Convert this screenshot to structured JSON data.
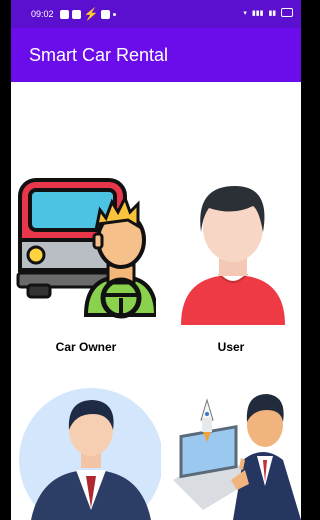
{
  "status": {
    "time": "09:02"
  },
  "appbar": {
    "title": "Smart Car Rental"
  },
  "options": [
    {
      "label": "Car  Owner",
      "icon": "car-owner-icon"
    },
    {
      "label": "User",
      "icon": "user-icon"
    },
    {
      "label": "",
      "icon": "businessman-icon"
    },
    {
      "label": "",
      "icon": "startup-presenter-icon"
    }
  ],
  "colors": {
    "appbar": "#6a0dea",
    "statusbar": "#5b10d0"
  }
}
